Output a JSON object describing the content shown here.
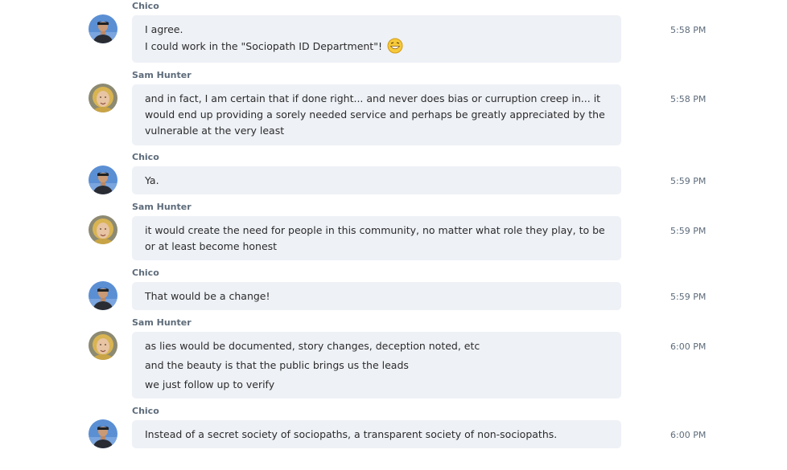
{
  "messages": [
    {
      "sender": "Chico",
      "avatar": "chico",
      "lines": [
        "I agree.",
        "I could work in the \"Sociopath ID Department\"!"
      ],
      "emoji": "grinning-face-icon",
      "time": "5:58 PM"
    },
    {
      "sender": "Sam Hunter",
      "avatar": "sam",
      "text": "and in fact, I am certain that if done right... and never does bias or curruption creep in... it would end up providing a sorely needed service and perhaps be greatly appreciated by the vulnerable at the very least",
      "time": "5:58 PM"
    },
    {
      "sender": "Chico",
      "avatar": "chico",
      "lines": [
        "Ya."
      ],
      "time": "5:59 PM"
    },
    {
      "sender": "Sam Hunter",
      "avatar": "sam",
      "text": "it would create the need for people in this community, no matter what role they play, to be or at least become honest",
      "time": "5:59 PM"
    },
    {
      "sender": "Chico",
      "avatar": "chico",
      "lines": [
        "That would be a change!"
      ],
      "time": "5:59 PM"
    },
    {
      "sender": "Sam Hunter",
      "avatar": "sam",
      "lines": [
        "as lies would be documented, story changes, deception noted, etc",
        "and the beauty is that the public brings us the leads",
        "we just follow up to verify"
      ],
      "time": "6:00 PM"
    },
    {
      "sender": "Chico",
      "avatar": "chico",
      "lines": [
        "Instead of a secret society of sociopaths, a transparent society of non-sociopaths."
      ],
      "time": "6:00 PM"
    }
  ],
  "colors": {
    "bubble": "#eef1f6",
    "sender": "#5d6b7a",
    "text": "#2b2b2b"
  }
}
